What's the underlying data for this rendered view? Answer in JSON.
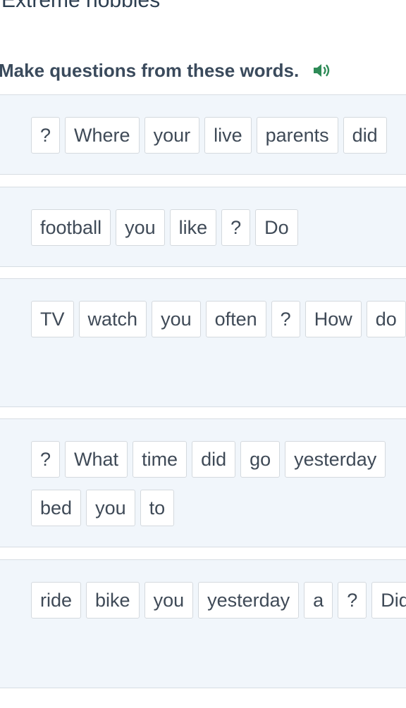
{
  "header": {
    "title": "Extreme  hobbies"
  },
  "exercise": {
    "instruction": "Make questions from these words.",
    "audio_icon": "speaker-icon",
    "accent_color": "#2e8b57"
  },
  "panels": [
    {
      "words": [
        "?",
        "Where",
        "your",
        "live",
        "parents",
        "did"
      ]
    },
    {
      "words": [
        "football",
        "you",
        "like",
        "?",
        "Do"
      ]
    },
    {
      "words": [
        "TV",
        "watch",
        "you",
        "often",
        "?",
        "How",
        "do"
      ]
    },
    {
      "words": [
        "?",
        "What",
        "time",
        "did",
        "go",
        "yesterday",
        "bed",
        "you",
        "to"
      ]
    },
    {
      "words": [
        "ride",
        "bike",
        "you",
        "yesterday",
        "a",
        "?",
        "Did"
      ]
    }
  ]
}
